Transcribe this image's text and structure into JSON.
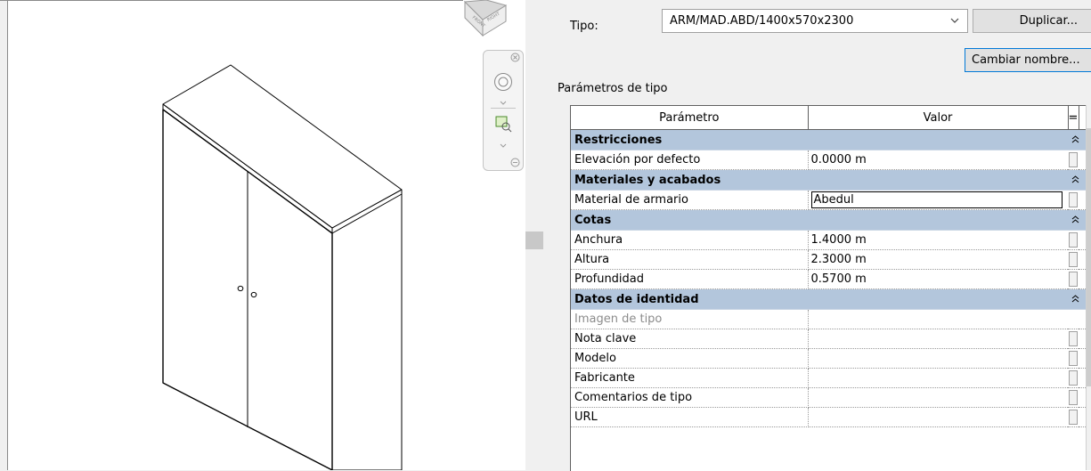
{
  "type_selector": {
    "label": "Tipo:",
    "value": "ARM/MAD.ABD/1400x570x2300"
  },
  "buttons": {
    "duplicate": "Duplicar...",
    "rename": "Cambiar nombre..."
  },
  "type_params": {
    "caption": "Parámetros de tipo",
    "headers": {
      "parameter": "Parámetro",
      "value": "Valor",
      "formula": "="
    },
    "groups": [
      {
        "name": "Restricciones",
        "rows": [
          {
            "param": "Elevación por defecto",
            "value": "0.0000 m"
          }
        ]
      },
      {
        "name": "Materiales y acabados",
        "rows": [
          {
            "param": "Material de armario",
            "value": "Abedul"
          }
        ]
      },
      {
        "name": "Cotas",
        "rows": [
          {
            "param": "Anchura",
            "value": "1.4000 m"
          },
          {
            "param": "Altura",
            "value": "2.3000 m"
          },
          {
            "param": "Profundidad",
            "value": "0.5700 m"
          }
        ]
      },
      {
        "name": "Datos de identidad",
        "rows": [
          {
            "param": "Imagen de tipo",
            "value": ""
          },
          {
            "param": "Nota clave",
            "value": ""
          },
          {
            "param": "Modelo",
            "value": ""
          },
          {
            "param": "Fabricante",
            "value": ""
          },
          {
            "param": "Comentarios de tipo",
            "value": ""
          },
          {
            "param": "URL",
            "value": ""
          }
        ]
      }
    ]
  },
  "colors": {
    "group_header_bg": "#b3c6dc",
    "button_focus_border": "#0078d7"
  },
  "icons": {
    "viewcube": "viewcube-icon",
    "steering_wheel": "steering-wheel-icon",
    "zoom": "zoom-region-icon",
    "collapse": "double-chevron-up-icon",
    "dropdown": "chevron-down-icon"
  }
}
